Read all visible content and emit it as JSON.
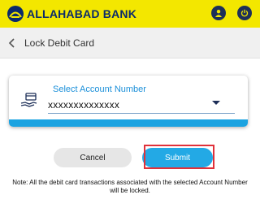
{
  "header": {
    "bank_name": "ALLAHABAD BANK",
    "profile_icon": "user-icon",
    "power_icon": "power-icon",
    "colors": {
      "bar": "#f3e700",
      "brand": "#0a2a6b"
    }
  },
  "subheader": {
    "title": "Lock Debit Card",
    "back_icon": "chevron-left-icon"
  },
  "account_card": {
    "label": "Select Account Number",
    "value": "xxxxxxxxxxxxxx",
    "icon": "card-in-hand-icon",
    "accent": "#1ba3e1"
  },
  "actions": {
    "cancel_label": "Cancel",
    "submit_label": "Submit",
    "submit_color": "#23a9e5",
    "highlight_color": "#e0313a"
  },
  "note": "Note: All the debit card transactions associated with the selected Account Number will be locked."
}
